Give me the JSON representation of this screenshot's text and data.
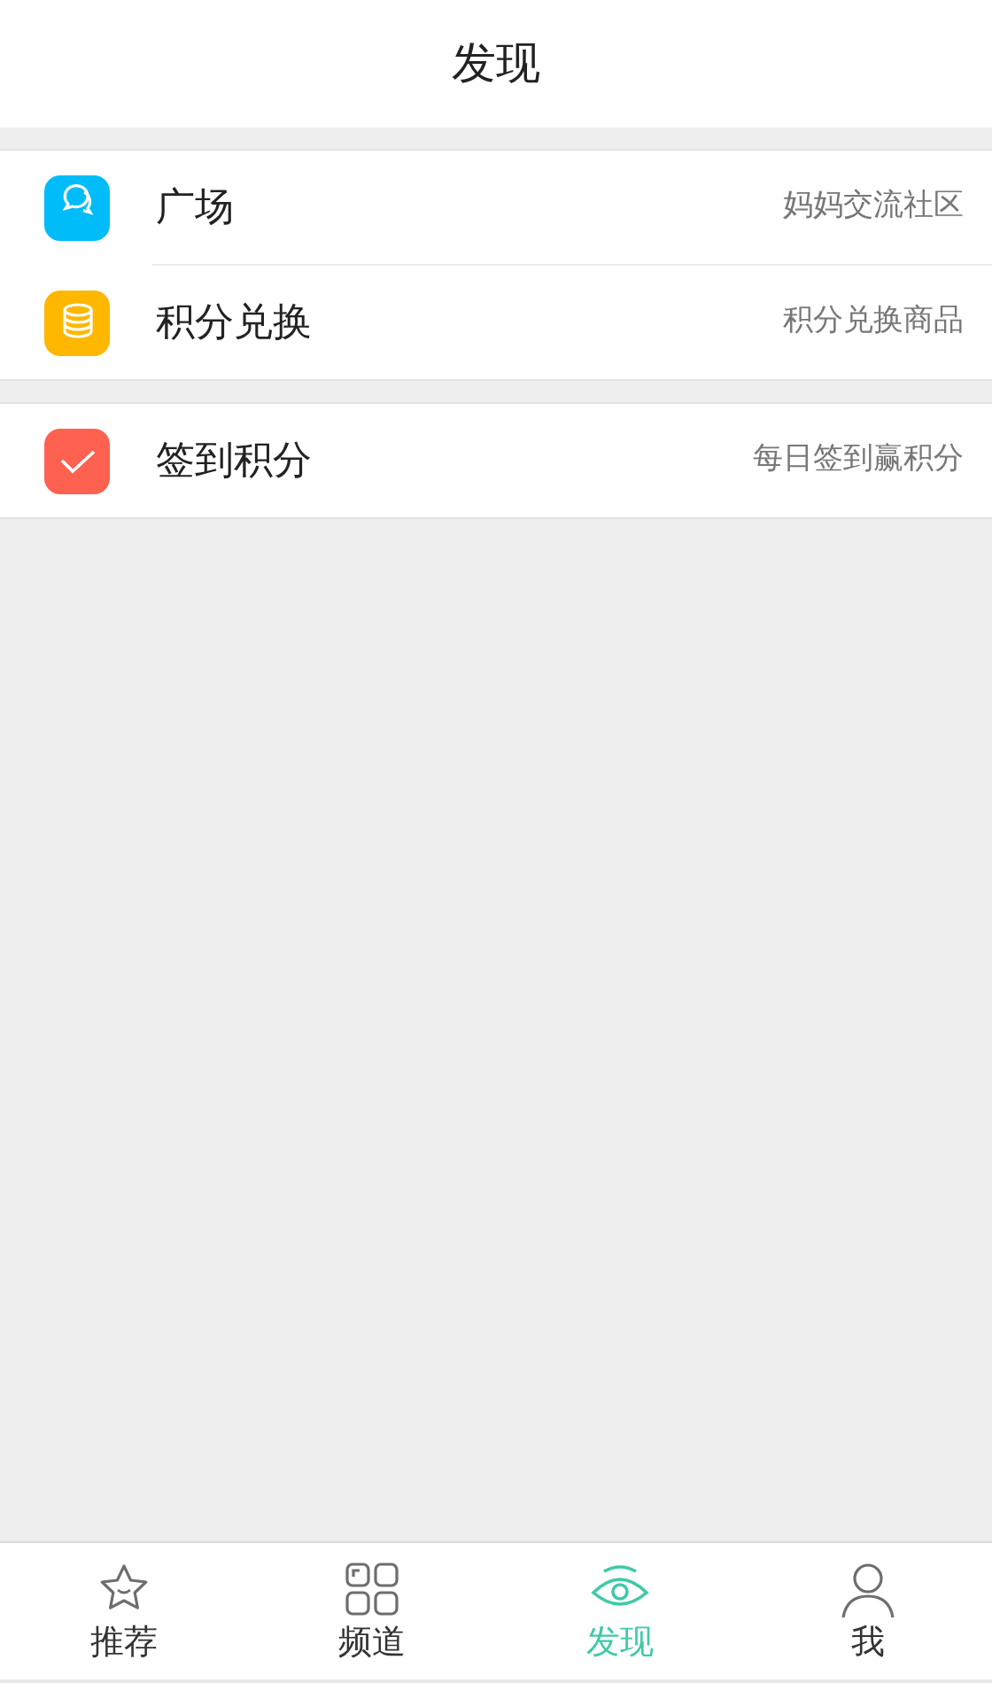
{
  "header": {
    "title": "发现"
  },
  "groups": [
    {
      "items": [
        {
          "kind": "chat",
          "color": "#00bcf9",
          "label": "广场",
          "detail": "妈妈交流社区"
        },
        {
          "kind": "coins",
          "color": "#ffb700",
          "label": "积分兑换",
          "detail": "积分兑换商品"
        }
      ]
    },
    {
      "items": [
        {
          "kind": "check",
          "color": "#ff6150",
          "label": "签到积分",
          "detail": "每日签到赢积分"
        }
      ]
    }
  ],
  "tabs": [
    {
      "kind": "star",
      "label": "推荐",
      "selected": false
    },
    {
      "kind": "grid",
      "label": "频道",
      "selected": false
    },
    {
      "kind": "eye",
      "label": "发现",
      "selected": true
    },
    {
      "kind": "person",
      "label": "我",
      "selected": false
    }
  ]
}
